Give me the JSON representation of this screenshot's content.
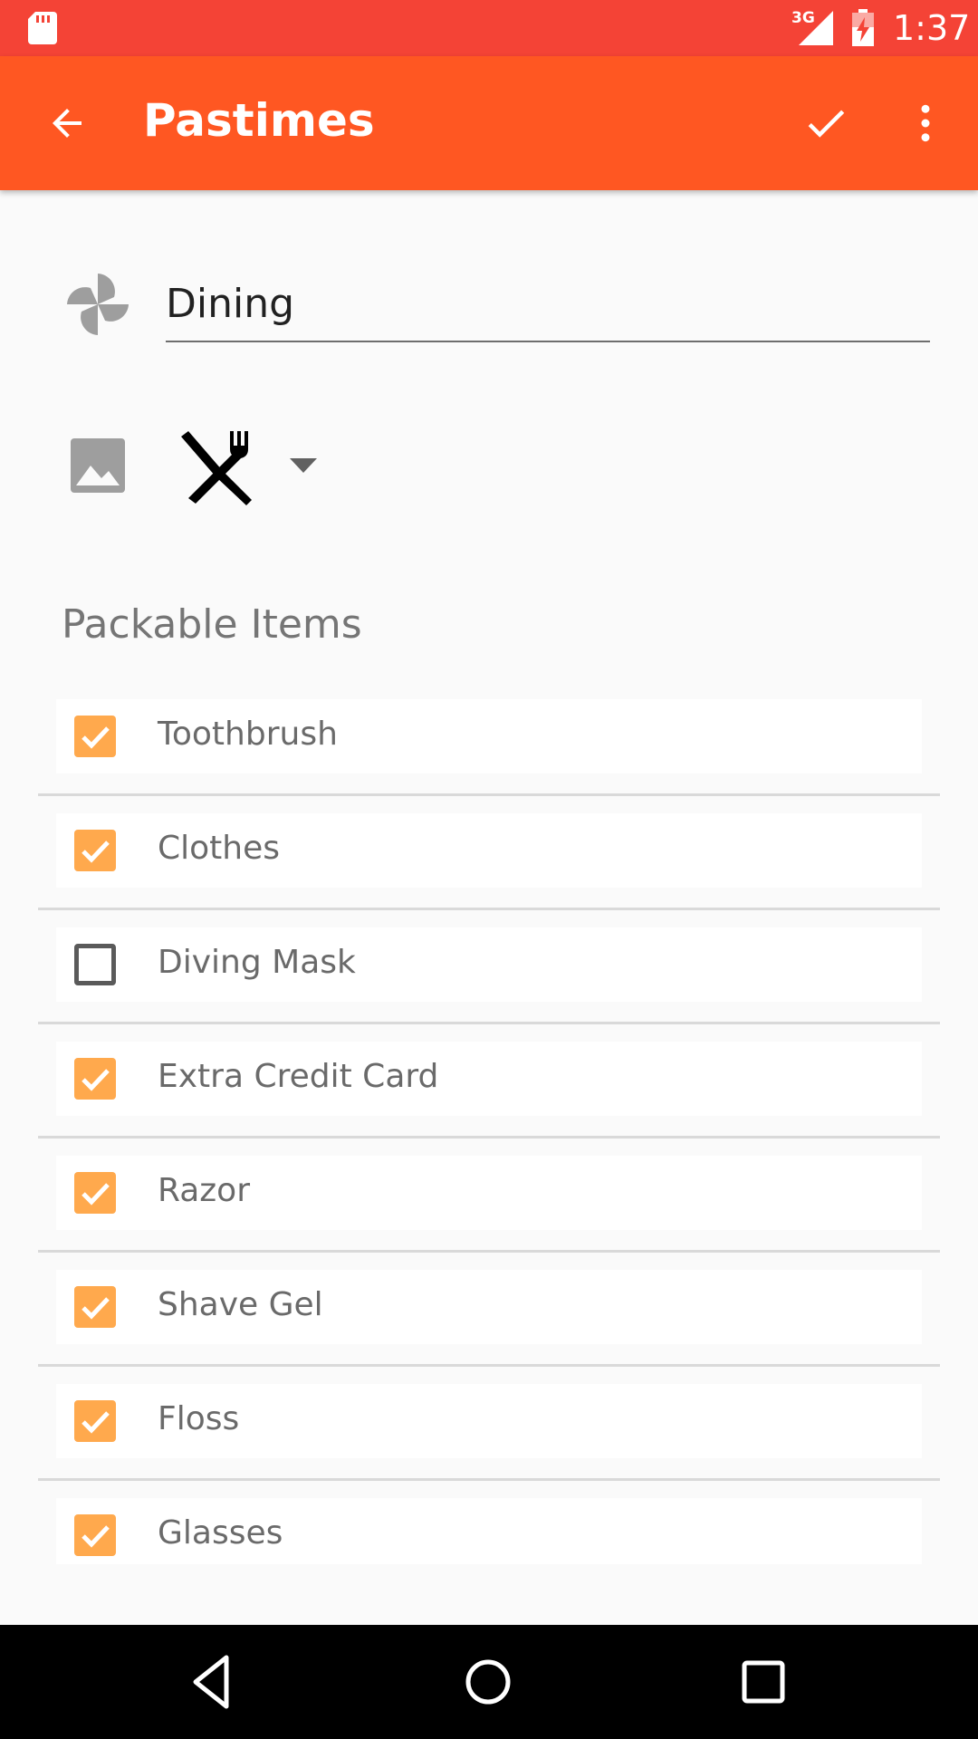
{
  "status_bar": {
    "network_type": "3G",
    "time": "1:37",
    "icons": [
      "sd-card-icon",
      "signal-icon",
      "battery-charging-icon"
    ]
  },
  "app_bar": {
    "title": "Pastimes",
    "icons": [
      "arrow-back-icon",
      "check-icon",
      "more-vert-icon"
    ]
  },
  "name_field": {
    "value": "Dining",
    "icon": "pinwheel-icon"
  },
  "icon_picker": {
    "icons": [
      "image-icon",
      "dining-icon",
      "dropdown-arrow-icon"
    ]
  },
  "section": {
    "title": "Packable Items"
  },
  "items": [
    {
      "label": "Toothbrush",
      "checked": true
    },
    {
      "label": "Clothes",
      "checked": true
    },
    {
      "label": "Diving Mask",
      "checked": false
    },
    {
      "label": "Extra Credit Card",
      "checked": true
    },
    {
      "label": "Razor",
      "checked": true
    },
    {
      "label": "Shave Gel",
      "checked": true
    },
    {
      "label": "Floss",
      "checked": true
    },
    {
      "label": "Glasses",
      "checked": true
    }
  ],
  "colors": {
    "status_bar": "#f44336",
    "app_bar": "#ff5722",
    "checkbox_checked": "#ffa94d",
    "background": "#fafafa"
  },
  "nav_bar": {
    "icons": [
      "nav-back-icon",
      "nav-home-icon",
      "nav-recents-icon"
    ]
  }
}
